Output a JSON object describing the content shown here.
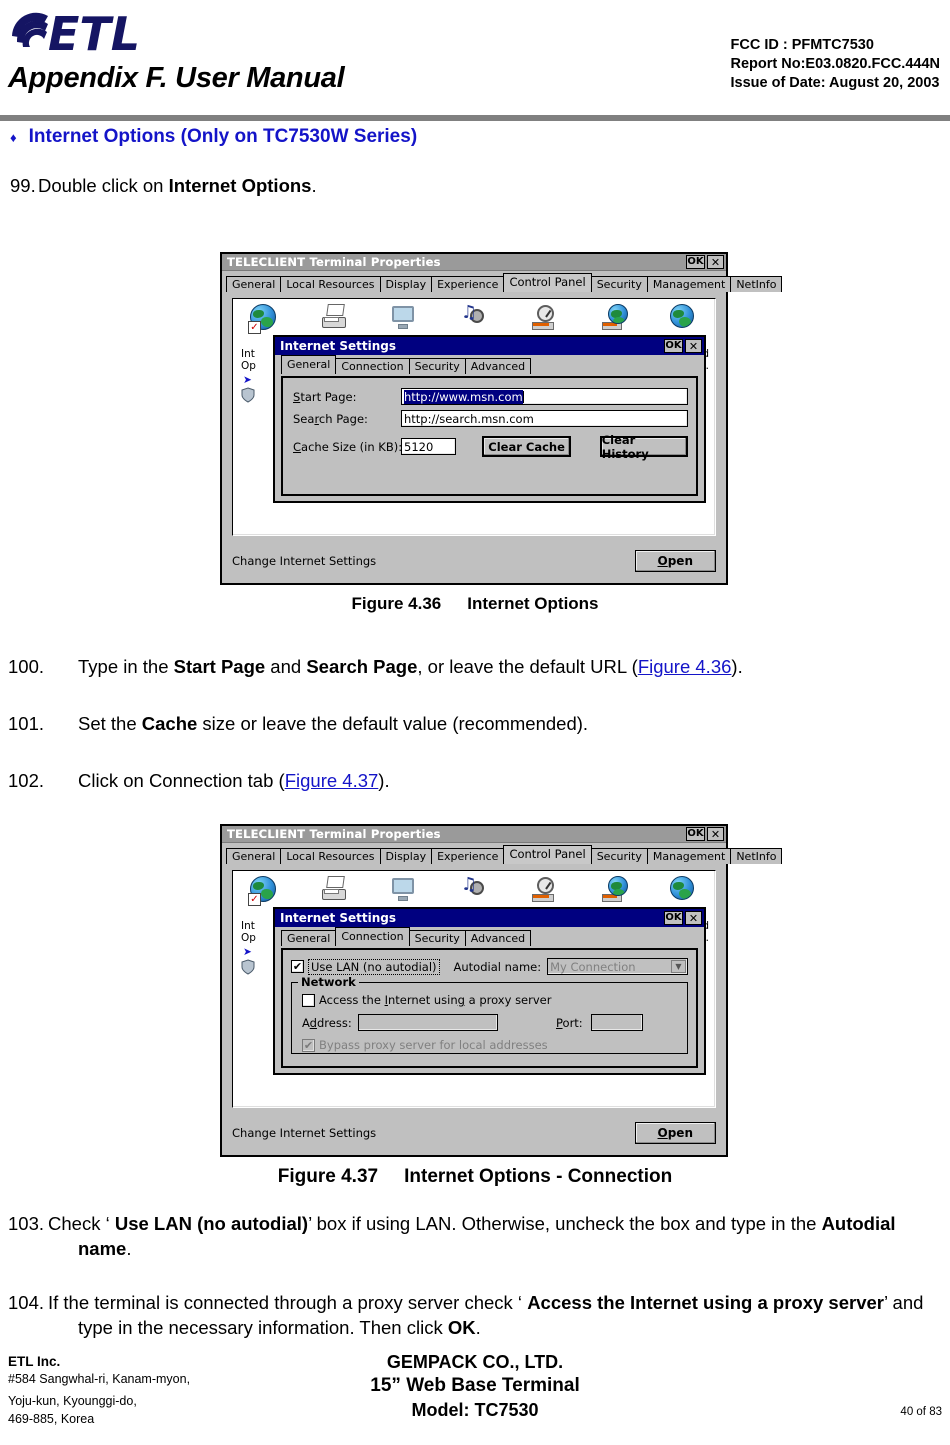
{
  "header": {
    "logo_text": "ETL",
    "doc_title": "Appendix F. User Manual",
    "fcc_id": "FCC ID : PFMTC7530",
    "report_no": "Report No:E03.0820.FCC.444N",
    "issue_date": "Issue of Date: August 20, 2003"
  },
  "section": {
    "bullet": "♦",
    "heading": "Internet Options (Only on TC7530W Series)"
  },
  "steps": {
    "s99_num": "99.",
    "s99_a": "Double click on ",
    "s99_b": "Internet Options",
    "s99_c": ".",
    "s100_num": "100.",
    "s100_a": "Type in the ",
    "s100_b": "Start Page",
    "s100_c": " and ",
    "s100_d": "Search Page",
    "s100_e": ", or leave the default URL (",
    "s100_link": "Figure 4.36",
    "s100_f": ").",
    "s101_num": "101.",
    "s101_a": "Set the ",
    "s101_b": "Cache",
    "s101_c": " size or leave the default value (recommended).",
    "s102_num": "102.",
    "s102_a": "Click on Connection tab (",
    "s102_link": "Figure 4.37",
    "s102_b": ").",
    "s103_num": "103.",
    "s103_a": "Check ‘ ",
    "s103_b": "Use LAN (no autodial)",
    "s103_c": "’  box if using LAN.  Otherwise, uncheck the box and type in the ",
    "s103_d": "Autodial name",
    "s103_e": ".",
    "s104_num": "104.",
    "s104_a": "If the terminal is connected through a proxy server check ‘ ",
    "s104_b": "Access the Internet using a proxy server",
    "s104_c": "’  and type in the necessary information.  Then click ",
    "s104_d": "OK",
    "s104_e": "."
  },
  "figures": {
    "fig36_label": "Figure 4.36",
    "fig36_title": "Internet Options",
    "fig37_label": "Figure 4.37",
    "fig37_title": "Internet Options - Connection"
  },
  "dialog": {
    "title": "TELECLIENT Terminal Properties",
    "ok_label": "OK",
    "close_label": "✕",
    "tabs": [
      {
        "label": "General",
        "active": false
      },
      {
        "label": "Local Resources",
        "active": false
      },
      {
        "label": "Display",
        "active": false
      },
      {
        "label": "Experience",
        "active": false
      },
      {
        "label": "Control Panel",
        "active": true
      },
      {
        "label": "Security",
        "active": false
      },
      {
        "label": "Management",
        "active": false
      },
      {
        "label": "NetInfo",
        "active": false
      }
    ],
    "status_text": "Change Internet Settings",
    "open_label": "Open",
    "behind_text_1": "Int",
    "behind_text_2": "Op",
    "behind_text_right_1": "and",
    "behind_text_right_2": "o…"
  },
  "settings": {
    "title": "Internet Settings",
    "ok_label": "OK",
    "close_label": "✕",
    "tabs": [
      {
        "label": "General"
      },
      {
        "label": "Connection"
      },
      {
        "label": "Security"
      },
      {
        "label": "Advanced"
      }
    ],
    "general": {
      "active_tab": "General",
      "start_page_label": "Start Page:",
      "start_page_value": "http://www.msn.com",
      "search_page_label": "Search Page:",
      "search_page_value": "http://search.msn.com",
      "cache_size_label": "Cache Size (in KB):",
      "cache_size_value": "5120",
      "clear_cache_label": "Clear Cache",
      "clear_history_label": "Clear History"
    },
    "connection": {
      "active_tab": "Connection",
      "use_lan_label": "Use LAN (no autodial)",
      "use_lan_checked": "✔",
      "autodial_name_label": "Autodial name:",
      "autodial_name_value": "My Connection",
      "network_group_label": "Network",
      "proxy_label": "Access the Internet using a proxy server",
      "proxy_checked": "",
      "address_label": "Address:",
      "address_value": "",
      "port_label": "Port:",
      "port_value": "",
      "bypass_label": "Bypass proxy server for local addresses",
      "bypass_checked": "✔"
    }
  },
  "control_panel_icons": [
    {
      "name": "internet-options-icon",
      "label": ""
    },
    {
      "name": "printer-icon",
      "label": ""
    },
    {
      "name": "display-icon",
      "label": ""
    },
    {
      "name": "volume-sounds-icon",
      "label": ""
    },
    {
      "name": "date-time-icon",
      "label": ""
    },
    {
      "name": "network-dialup-icon",
      "label": ""
    },
    {
      "name": "system-globe-icon",
      "label": ""
    }
  ],
  "footer": {
    "company": "ETL Inc.",
    "addr1": "#584 Sangwhal-ri, Kanam-myon,",
    "addr2": "Yoju-kun, Kyounggi-do,",
    "addr3": "469-885, Korea",
    "center1": "GEMPACK CO., LTD.",
    "center2": "15” Web Base Terminal",
    "center3": "Model: TC7530",
    "page": "40 of 83"
  }
}
